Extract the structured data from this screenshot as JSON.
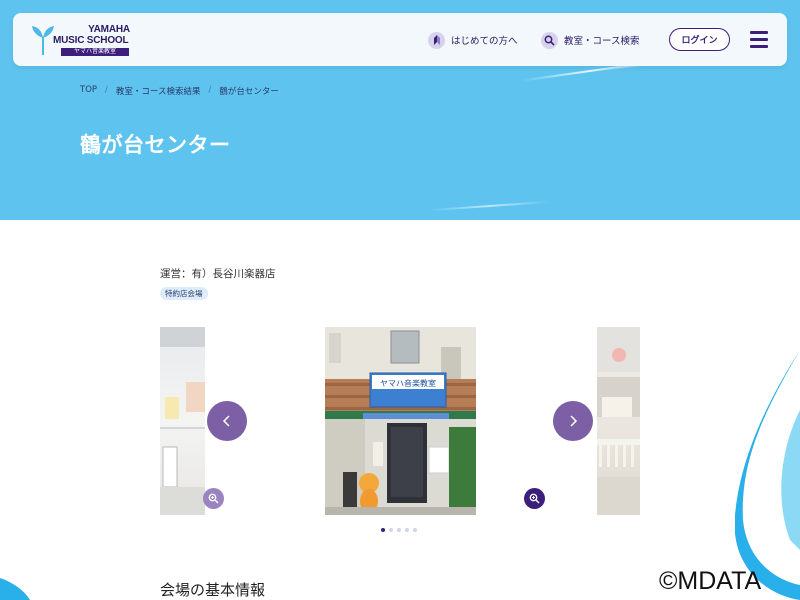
{
  "header": {
    "logo": {
      "line1": "YAMAHA",
      "line2": "MUSIC SCHOOL",
      "badge": "ヤマハ音楽教室",
      "icon": "yamaha-music-school-logo"
    },
    "nav": [
      {
        "label": "はじめての方へ",
        "icon": "beginner-leaf-icon"
      },
      {
        "label": "教室・コース検索",
        "icon": "search-icon"
      }
    ],
    "login_label": "ログイン",
    "menu_icon": "hamburger-menu-icon"
  },
  "breadcrumb": [
    "TOP",
    "教室・コース検索結果",
    "鶴が台センター"
  ],
  "page_title": "鶴が台センター",
  "operator": "運営：有）長谷川楽器店",
  "tag": "特約店会場",
  "carousel": {
    "sign_text": "ヤマハ音楽教室",
    "slide_count": 5,
    "active_index": 0
  },
  "section_title": "会場の基本情報",
  "copyright": "©MDATA",
  "colors": {
    "hero": "#5ec4ef",
    "brand": "#3b1f7a",
    "arrow": "#7c5fa4",
    "tag": "#dcecf9"
  }
}
